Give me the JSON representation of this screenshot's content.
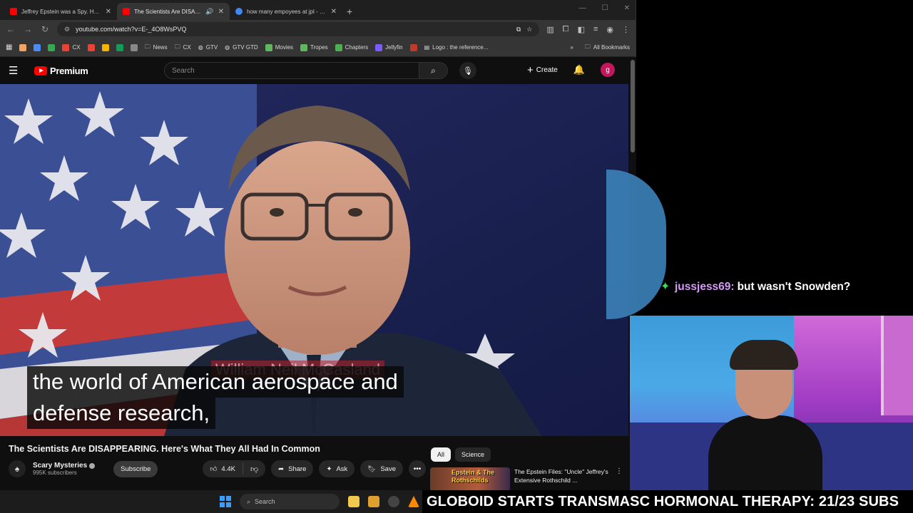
{
  "browser": {
    "tabs": [
      {
        "title": "Jeffrey Epstein was a Spy. Here's",
        "active": false,
        "favicon_color": "#ff0000"
      },
      {
        "title": "The Scientists Are DISAPPEARING",
        "active": true,
        "favicon_color": "#ff0000"
      },
      {
        "title": "how many empoyees at jpl - Go",
        "active": false,
        "favicon_color": "#4285f4"
      }
    ],
    "new_tab": "+",
    "url": "youtube.com/watch?v=E-_4O8WsPVQ",
    "bookmarks": [
      {
        "label": "",
        "color": "#f4a261"
      },
      {
        "label": "",
        "color": "#4b8bf4"
      },
      {
        "label": "",
        "color": "#34a853"
      },
      {
        "label": "CX",
        "color": "#ea4335"
      },
      {
        "label": "",
        "color": "#ea4335"
      },
      {
        "label": "",
        "color": "#f4b400"
      },
      {
        "label": "",
        "color": "#0f9d58"
      },
      {
        "label": "",
        "color": "#888888"
      },
      {
        "label": "News",
        "color": "#9aa0a6"
      },
      {
        "label": "CX",
        "color": "#9aa0a6"
      },
      {
        "label": "GTV",
        "color": "#dddddd"
      },
      {
        "label": "GTV GTD",
        "color": "#dddddd"
      },
      {
        "label": "Movies",
        "color": "#5fb85f"
      },
      {
        "label": "Tropes",
        "color": "#5fb85f"
      },
      {
        "label": "Chapters",
        "color": "#4caf50"
      },
      {
        "label": "Jellyfin",
        "color": "#7b5cff"
      },
      {
        "label": "",
        "color": "#c0392b"
      },
      {
        "label": "Logo : the reference...",
        "color": "#dddddd"
      }
    ],
    "all_bookmarks": "All Bookmarks",
    "more_bookmarks": "»"
  },
  "youtube": {
    "logo_text": "Premium",
    "search_placeholder": "Search",
    "create_label": "Create",
    "avatar_letter": "g",
    "caption_line1": "the world of American aerospace and",
    "caption_line2": "defense research,",
    "lower_third": "William Neil McCasland",
    "video_title": "The Scientists Are DISAPPEARING. Here's What They All Had In Common",
    "channel_name": "Scary Mysteries",
    "subscribers": "995K subscribers",
    "subscribe_label": "Subscribe",
    "likes": "4.4K",
    "share_label": "Share",
    "ask_label": "Ask",
    "save_label": "Save",
    "more_label": "•••",
    "chips": [
      "All",
      "Science"
    ],
    "rec_thumb_text": "Epstein & The Rothschilds",
    "rec_title": "The Epstein Files: \"Uncle\" Jeffrey's Extensive Rothschild ..."
  },
  "stream": {
    "chat_user": "jussjess69:",
    "chat_text": "but wasn't Snowden?",
    "banner": "GLOBOID STARTS TRANSMASC HORMONAL THERAPY: 21/23 SUBS"
  },
  "taskbar": {
    "search_label": "Search"
  },
  "colors": {
    "yt_red": "#ff0000",
    "chat_username": "#d59bf6",
    "chat_badge": "#3ddc57",
    "avatar_bg": "#c2185b"
  }
}
